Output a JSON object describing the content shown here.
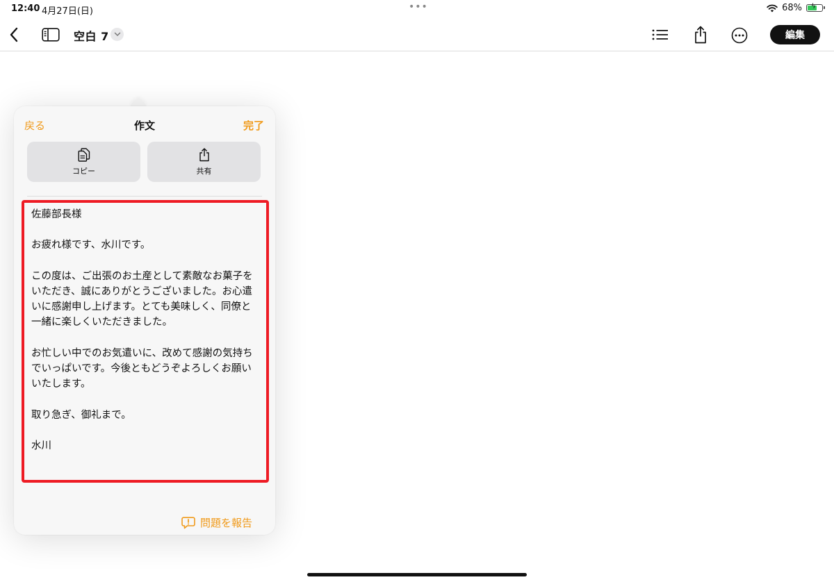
{
  "status_bar": {
    "time": "12:40",
    "date": "4月27日(日)",
    "battery_percent_text": "68%",
    "battery_level": 0.68,
    "battery_color": "#34c759"
  },
  "toolbar": {
    "document_title": "空白 7",
    "edit_label": "編集",
    "icons": [
      "chevron-left-icon",
      "sidebar-icon",
      "chevron-down-icon",
      "list-icon",
      "share-icon",
      "more-icon"
    ]
  },
  "popover": {
    "back_label": "戻る",
    "title": "作文",
    "done_label": "完了",
    "copy_label": "コピー",
    "share_label": "共有",
    "composed_text": "佐藤部長様\n\nお疲れ様です、水川です。\n\nこの度は、ご出張のお土産として素敵なお菓子をいただき、誠にありがとうございました。お心遣いに感謝申し上げます。とても美味しく、同僚と一緒に楽しくいただきました。\n\nお忙しい中でのお気遣いに、改めて感謝の気持ちでいっぱいです。今後ともどうぞよろしくお願いいたします。\n\n取り急ぎ、御礼まで。\n\n水川",
    "report_label": "問題を報告",
    "accent_color": "#f09a1a",
    "highlight_color": "#ee1b24"
  }
}
